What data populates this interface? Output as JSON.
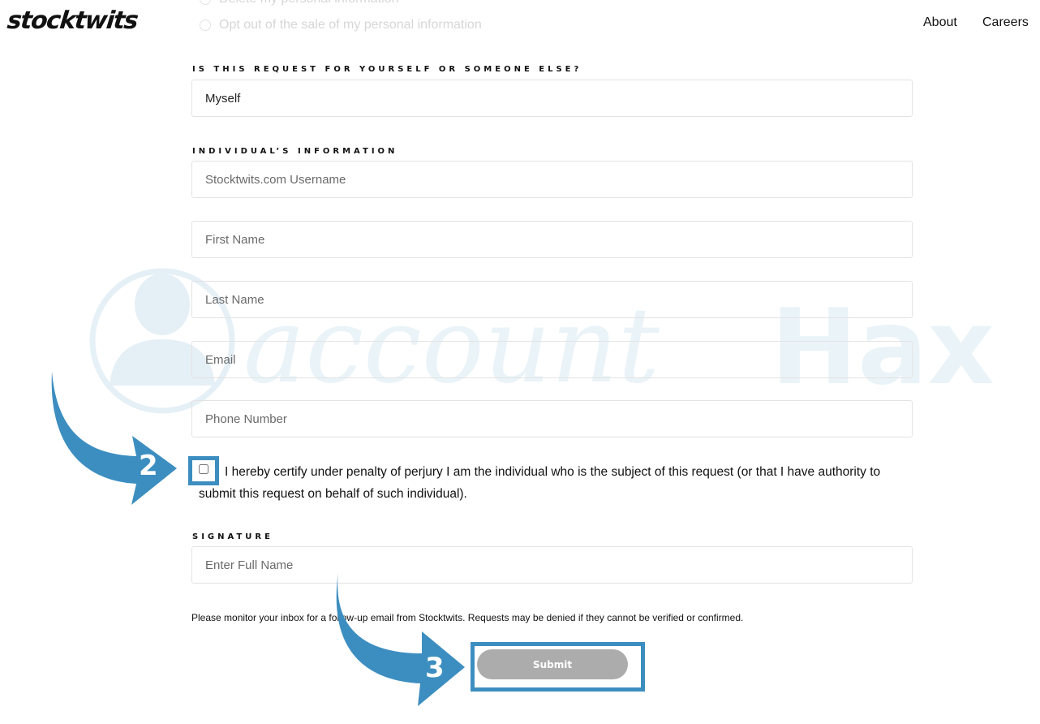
{
  "header": {
    "logo": "stocktwits",
    "nav": [
      "About",
      "Careers"
    ]
  },
  "faded_options": [
    "Delete my personal information",
    "Opt out of the sale of my personal information"
  ],
  "request_section": {
    "label": "IS THIS REQUEST FOR YOURSELF OR SOMEONE ELSE?",
    "value": "Myself"
  },
  "individual_section": {
    "label": "INDIVIDUAL’S INFORMATION",
    "username_placeholder": "Stocktwits.com Username",
    "first_name_placeholder": "First Name",
    "last_name_placeholder": "Last Name",
    "email_placeholder": "Email",
    "phone_placeholder": "Phone Number"
  },
  "certify": {
    "checked": false,
    "text": "I hereby certify under penalty of perjury I am the individual who is the subject of this request (or that I have authority to submit this request on behalf of such individual)."
  },
  "signature_section": {
    "label": "SIGNATURE",
    "placeholder": "Enter Full Name"
  },
  "notice": "Please monitor your inbox for a follow-up email from Stocktwits. Requests may be denied if they cannot be verified or confirmed.",
  "submit_label": "Submit",
  "annotations": {
    "step_2": "2",
    "step_3": "3",
    "color": "#3d8ec0"
  },
  "watermark": {
    "text_script": "account",
    "text_bold": "Hax"
  }
}
